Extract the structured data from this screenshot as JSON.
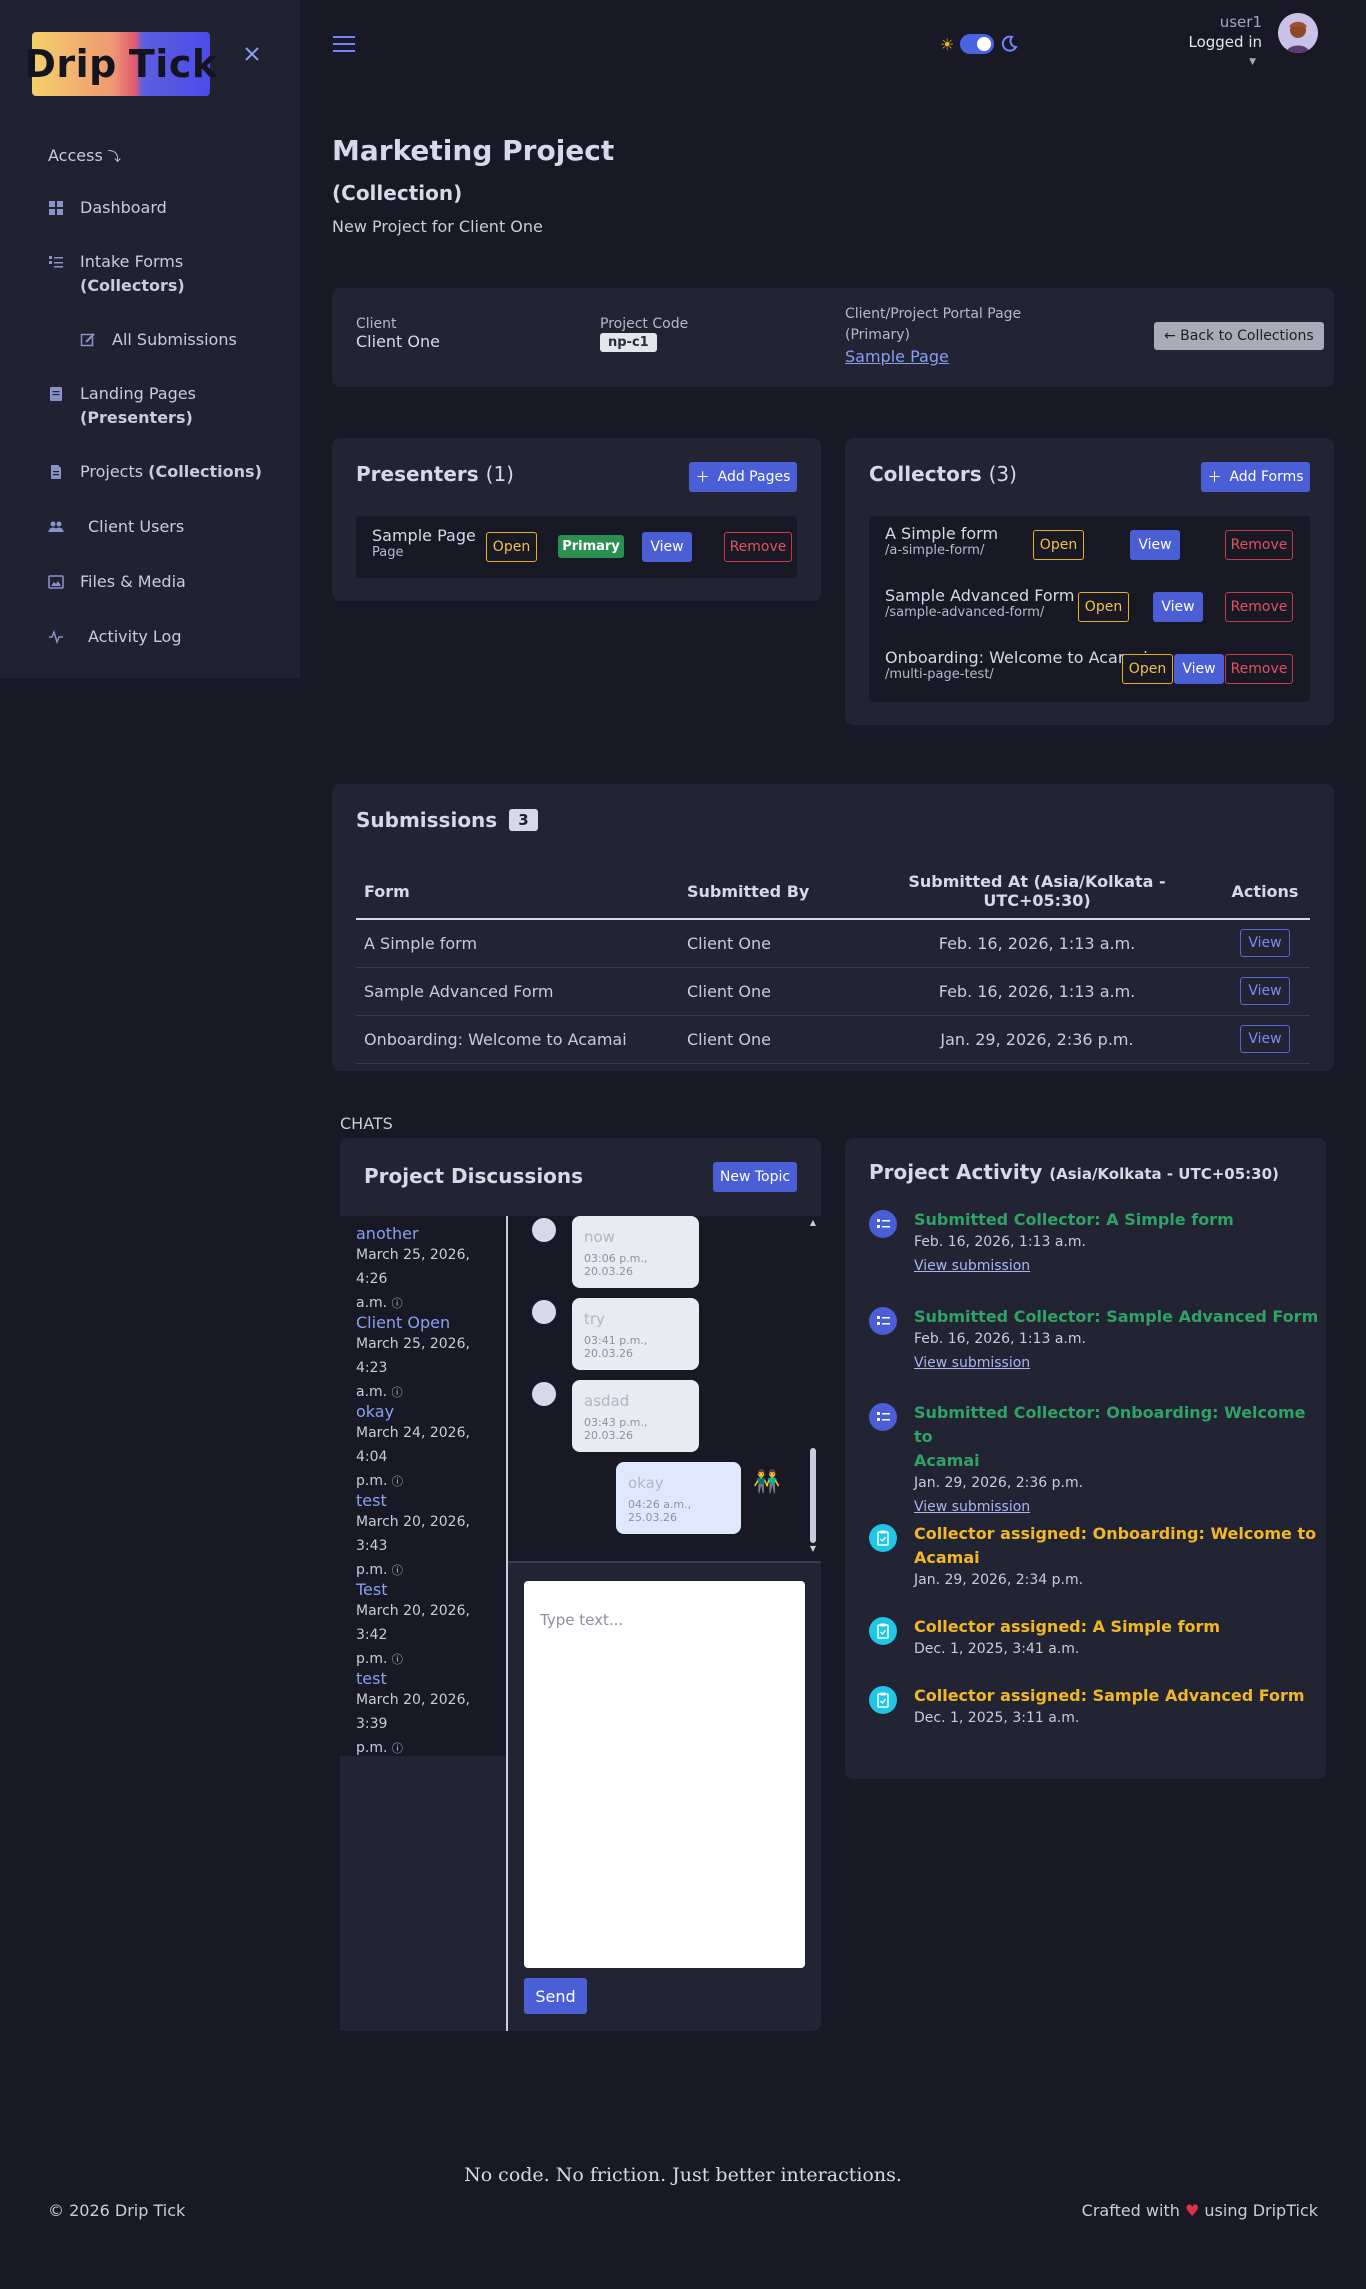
{
  "brand": {
    "logo_left": "Drip",
    "logo_right": "Tick"
  },
  "sidebar": {
    "access_label": "Access",
    "items": [
      {
        "label": "Dashboard"
      },
      {
        "label": "Intake Forms",
        "sub": "(Collectors)"
      },
      {
        "label": "All Submissions"
      },
      {
        "label": "Landing Pages",
        "sub": "(Presenters)"
      },
      {
        "label": "Projects",
        "sub": "(Collections)"
      },
      {
        "label": "Client Users"
      },
      {
        "label": "Files & Media"
      },
      {
        "label": "Activity Log"
      }
    ]
  },
  "header": {
    "username": "user1",
    "status": "Logged in"
  },
  "page": {
    "title": "Marketing Project",
    "subtitle": "(Collection)",
    "description": "New Project for Client One"
  },
  "info": {
    "client_label": "Client",
    "client_value": "Client One",
    "code_label": "Project Code",
    "code_value": "np-c1",
    "portal_label": "Client/Project Portal Page",
    "portal_sub": "(Primary)",
    "portal_link": "Sample Page",
    "back_button": "← Back to Collections"
  },
  "presenters": {
    "title": "Presenters",
    "count": "(1)",
    "add_button": "Add Pages",
    "items": [
      {
        "name": "Sample Page",
        "type": "Page",
        "open": "Open",
        "primary": "Primary",
        "view": "View",
        "remove": "Remove"
      }
    ]
  },
  "collectors": {
    "title": "Collectors",
    "count": "(3)",
    "add_button": "Add Forms",
    "items": [
      {
        "name": "A Simple form",
        "path": "/a-simple-form/",
        "open": "Open",
        "view": "View",
        "remove": "Remove"
      },
      {
        "name": "Sample Advanced Form",
        "path": "/sample-advanced-form/",
        "open": "Open",
        "view": "View",
        "remove": "Remove"
      },
      {
        "name": "Onboarding: Welcome to Acamai",
        "path": "/multi-page-test/",
        "open": "Open",
        "view": "View",
        "remove": "Remove"
      }
    ]
  },
  "submissions": {
    "title": "Submissions",
    "count": "3",
    "headers": [
      "Form",
      "Submitted By",
      "Submitted At (Asia/Kolkata - UTC+05:30)",
      "Actions"
    ],
    "rows": [
      {
        "form": "A Simple form",
        "by": "Client One",
        "at": "Feb. 16, 2026, 1:13 a.m.",
        "action": "View"
      },
      {
        "form": "Sample Advanced Form",
        "by": "Client One",
        "at": "Feb. 16, 2026, 1:13 a.m.",
        "action": "View"
      },
      {
        "form": "Onboarding: Welcome to Acamai",
        "by": "Client One",
        "at": "Jan. 29, 2026, 2:36 p.m.",
        "action": "View"
      }
    ]
  },
  "chats": {
    "label": "CHATS",
    "title": "Project Discussions",
    "new_topic": "New Topic",
    "topics": [
      {
        "name": "another",
        "date1": "March 25, 2026, 4:26",
        "date2": "a.m."
      },
      {
        "name": "Client Open",
        "date1": "March 25, 2026, 4:23",
        "date2": "a.m."
      },
      {
        "name": "okay",
        "date1": "March 24, 2026, 4:04",
        "date2": "p.m."
      },
      {
        "name": "test",
        "date1": "March 20, 2026, 3:43",
        "date2": "p.m."
      },
      {
        "name": "Test",
        "date1": "March 20, 2026, 3:42",
        "date2": "p.m."
      },
      {
        "name": "test",
        "date1": "March 20, 2026, 3:39",
        "date2": "p.m."
      }
    ],
    "messages": [
      {
        "text": "now",
        "time": "03:06 p.m., 20.03.26"
      },
      {
        "text": "try",
        "time": "03:41 p.m., 20.03.26"
      },
      {
        "text": "asdad",
        "time": "03:43 p.m., 20.03.26"
      },
      {
        "text": "okay",
        "time": "04:26 a.m., 25.03.26"
      }
    ],
    "input_placeholder": "Type text...",
    "send_button": "Send"
  },
  "activity": {
    "title": "Project Activity",
    "timezone": "(Asia/Kolkata - UTC+05:30)",
    "items": [
      {
        "title": "Submitted Collector: A Simple form",
        "date": "Feb. 16, 2026, 1:13 a.m.",
        "link": "View submission"
      },
      {
        "title": "Submitted Collector: Sample Advanced Form",
        "date": "Feb. 16, 2026, 1:13 a.m.",
        "link": "View submission"
      },
      {
        "title": "Submitted Collector: Onboarding: Welcome to",
        "title2": "Acamai",
        "date": "Jan. 29, 2026, 2:36 p.m.",
        "link": "View submission"
      },
      {
        "title": "Collector assigned: Onboarding: Welcome to",
        "title2": "Acamai",
        "date": "Jan. 29, 2026, 2:34 p.m."
      },
      {
        "title": "Collector assigned: A Simple form",
        "date": "Dec. 1, 2025, 3:41 a.m."
      },
      {
        "title": "Collector assigned: Sample Advanced Form",
        "date": "Dec. 1, 2025, 3:11 a.m."
      }
    ],
    "colors": {
      "submitted": "#2fa366",
      "assigned": "#f2b824"
    }
  },
  "footer": {
    "tagline": "No code. No friction. Just better interactions.",
    "copyright": "© 2026 Drip Tick",
    "crafted_prefix": "Crafted with",
    "crafted_suffix": "using DripTick"
  }
}
